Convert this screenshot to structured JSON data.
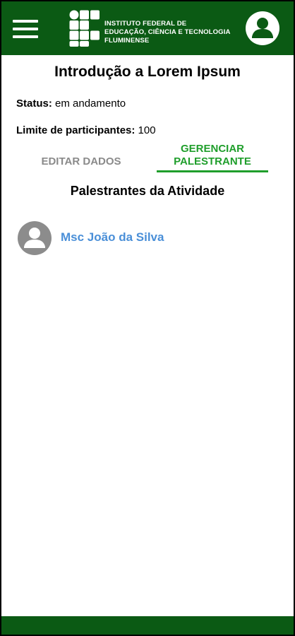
{
  "header": {
    "institution_line1": "INSTITUTO FEDERAL DE",
    "institution_line2": "EDUCAÇÃO, CIÊNCIA E TECNOLOGIA",
    "institution_line3": "FLUMINENSE",
    "menu_icon": "hamburger-menu-icon",
    "account_icon": "user-account-icon",
    "brand_color": "#0b5a14"
  },
  "activity": {
    "title": "Introdução a Lorem Ipsum",
    "status_label": "Status:",
    "status_value": "em andamento",
    "limit_label": "Limite de participantes:",
    "limit_value": "100"
  },
  "tabs": {
    "edit_label": "EDITAR DADOS",
    "manage_line1": "GERENCIAR",
    "manage_line2": "PALESTRANTE",
    "active": "manage",
    "active_color": "#1f9e2b",
    "inactive_color": "#8a8a8a"
  },
  "speakers": {
    "section_title": "Palestrantes da Atividade",
    "items": [
      {
        "name": "Msc João da Silva",
        "icon": "user-avatar-icon"
      }
    ],
    "link_color": "#4a8fd8"
  }
}
